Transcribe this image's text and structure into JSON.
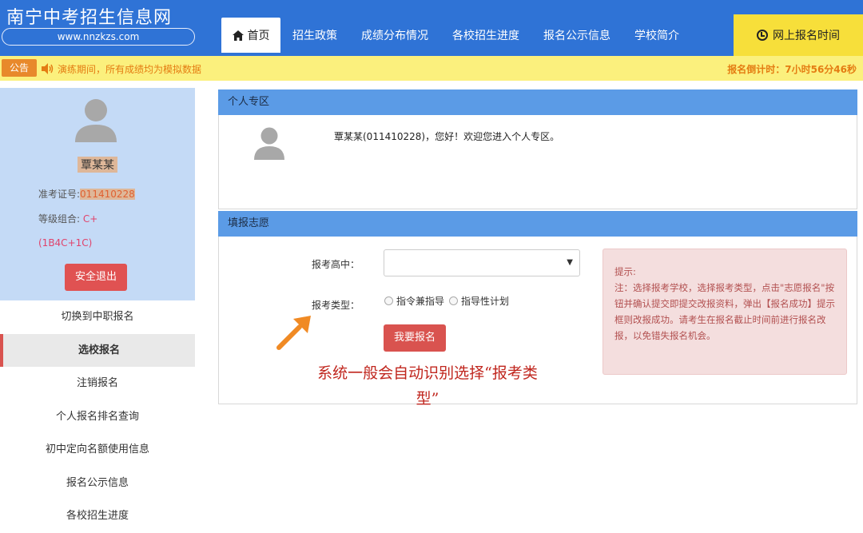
{
  "header": {
    "site_title": "南宁中考招生信息网",
    "site_url": "www.nnzkzs.com",
    "nav": {
      "home": "首页",
      "items": [
        "招生政策",
        "成绩分布情况",
        "各校招生进度",
        "报名公示信息",
        "学校简介"
      ],
      "time_button": "网上报名时间"
    }
  },
  "notice": {
    "badge": "公告",
    "text": "演练期间，所有成绩均为模拟数据",
    "countdown": "报名倒计时：7小时56分46秒"
  },
  "sidebar": {
    "name": "覃某某",
    "id_label": "准考证号:",
    "id_value": "011410228",
    "grade_label": "等级组合: ",
    "grade_value": "C+",
    "grade_detail": "(1B4C+1C)",
    "logout": "安全退出",
    "menu": [
      "切换到中职报名",
      "选校报名",
      "注销报名",
      "个人报名排名查询",
      "初中定向名额使用信息",
      "报名公示信息",
      "各校招生进度"
    ]
  },
  "personal": {
    "title": "个人专区",
    "welcome": "覃某某(011410228)，您好！欢迎您进入个人专区。"
  },
  "application": {
    "title": "填报志愿",
    "school_label": "报考高中：",
    "school_value": "",
    "type_label": "报考类型：",
    "type_options": [
      "指令兼指导",
      "指导性计划"
    ],
    "submit": "我要报名",
    "tip_title": "提示:",
    "tip_text": "注：选择报考学校，选择报考类型，点击\"志愿报名\"按钮并确认提交即提交改报资料，弹出【报名成功】提示框则改报成功。请考生在报名截止时间前进行报名改报，以免错失报名机会。"
  },
  "annotation": {
    "line1": "系统一般会自动识别选择“报考类",
    "line2": "型”"
  },
  "colors": {
    "header_blue": "#2f73d6",
    "panel_blue": "#5b9be6",
    "notice_yellow": "#fbf07d",
    "accent_red": "#d9534f",
    "annotation_orange": "#f08a24"
  }
}
